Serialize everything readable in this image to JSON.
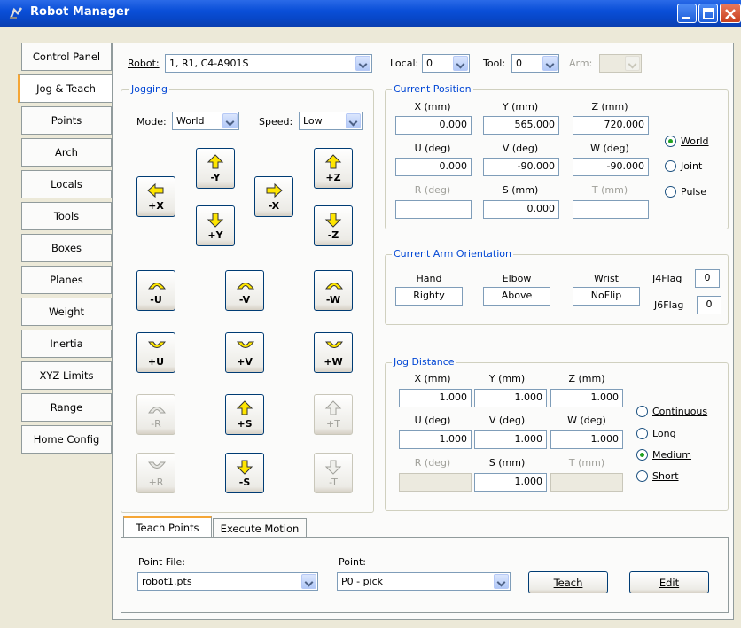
{
  "window": {
    "title": "Robot Manager"
  },
  "sidebar": {
    "tabs": [
      {
        "label": "Control Panel"
      },
      {
        "label": "Jog & Teach"
      },
      {
        "label": "Points"
      },
      {
        "label": "Arch"
      },
      {
        "label": "Locals"
      },
      {
        "label": "Tools"
      },
      {
        "label": "Boxes"
      },
      {
        "label": "Planes"
      },
      {
        "label": "Weight"
      },
      {
        "label": "Inertia"
      },
      {
        "label": "XYZ Limits"
      },
      {
        "label": "Range"
      },
      {
        "label": "Home Config"
      }
    ],
    "active_index": 1
  },
  "robot": {
    "label": "Robot:",
    "value": "1, R1, C4-A901S"
  },
  "local": {
    "label": "Local:",
    "value": "0"
  },
  "tool": {
    "label": "Tool:",
    "value": "0"
  },
  "arm": {
    "label": "Arm:",
    "value": ""
  },
  "jogging": {
    "title": "Jogging",
    "mode_label": "Mode:",
    "mode_value": "World",
    "speed_label": "Speed:",
    "speed_value": "Low",
    "buttons": {
      "minus_y": "-Y",
      "plus_z": "+Z",
      "plus_x": "+X",
      "minus_x": "-X",
      "plus_y": "+Y",
      "minus_z": "-Z",
      "minus_u": "-U",
      "minus_v": "-V",
      "minus_w": "-W",
      "plus_u": "+U",
      "plus_v": "+V",
      "plus_w": "+W",
      "minus_r": "-R",
      "plus_s": "+S",
      "plus_t": "+T",
      "plus_r": "+R",
      "minus_s": "-S",
      "minus_t": "-T"
    }
  },
  "current_position": {
    "title": "Current Position",
    "labels": {
      "x": "X (mm)",
      "y": "Y (mm)",
      "z": "Z (mm)",
      "u": "U (deg)",
      "v": "V (deg)",
      "w": "W (deg)",
      "r": "R (deg)",
      "s": "S (mm)",
      "t": "T (mm)"
    },
    "values": {
      "x": "0.000",
      "y": "565.000",
      "z": "720.000",
      "u": "0.000",
      "v": "-90.000",
      "w": "-90.000",
      "r": "",
      "s": "0.000",
      "t": ""
    },
    "radios": [
      {
        "label": "World",
        "selected": true
      },
      {
        "label": "Joint",
        "selected": false
      },
      {
        "label": "Pulse",
        "selected": false
      }
    ]
  },
  "arm_orientation": {
    "title": "Current Arm Orientation",
    "hand_label": "Hand",
    "hand_value": "Righty",
    "elbow_label": "Elbow",
    "elbow_value": "Above",
    "wrist_label": "Wrist",
    "wrist_value": "NoFlip",
    "j4flag_label": "J4Flag",
    "j4flag_value": "0",
    "j6flag_label": "J6Flag",
    "j6flag_value": "0"
  },
  "jog_distance": {
    "title": "Jog Distance",
    "labels": {
      "x": "X (mm)",
      "y": "Y (mm)",
      "z": "Z (mm)",
      "u": "U (deg)",
      "v": "V (deg)",
      "w": "W (deg)",
      "r": "R (deg)",
      "s": "S (mm)",
      "t": "T (mm)"
    },
    "values": {
      "x": "1.000",
      "y": "1.000",
      "z": "1.000",
      "u": "1.000",
      "v": "1.000",
      "w": "1.000",
      "r": "",
      "s": "1.000",
      "t": ""
    },
    "radios": [
      {
        "label": "Continuous",
        "selected": false
      },
      {
        "label": "Long",
        "selected": false
      },
      {
        "label": "Medium",
        "selected": true
      },
      {
        "label": "Short",
        "selected": false
      }
    ]
  },
  "bottom_tabs": [
    {
      "label": "Teach Points"
    },
    {
      "label": "Execute Motion"
    }
  ],
  "teach": {
    "point_file_label": "Point File:",
    "point_file_value": "robot1.pts",
    "point_label": "Point:",
    "point_value": "P0 - pick",
    "teach_button": "Teach",
    "edit_button": "Edit"
  },
  "colors": {
    "title_bar": "#0a4fd8",
    "group_title": "#0046d5",
    "active_tab_accent": "#f5a636",
    "face": "#ece9d8"
  }
}
